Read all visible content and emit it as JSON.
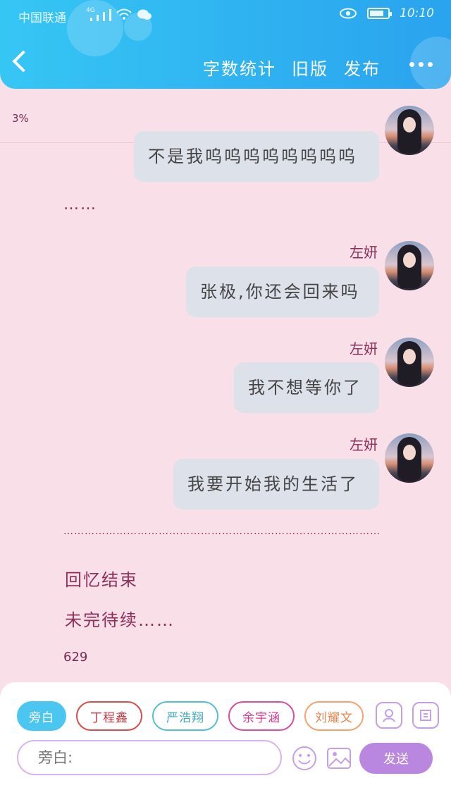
{
  "status_bar": {
    "carrier": "中国联通",
    "signal_label": "4G",
    "time": "10:10",
    "battery_level": 0.8
  },
  "header": {
    "actions": [
      "字数统计",
      "旧版",
      "发布"
    ],
    "more_icon": "more-horizontal-icon"
  },
  "progress": "3%",
  "messages": [
    {
      "text": "不是我呜呜呜呜呜呜呜呜"
    },
    {
      "name": "左妍",
      "text": "张极,你还会回来吗"
    },
    {
      "name": "左妍",
      "text": "我不想等你了"
    },
    {
      "name": "左妍",
      "text": "我要开始我的生活了"
    }
  ],
  "ellipsis_short": "……",
  "ellipsis_long": "………………………………………………………………………………",
  "narration": [
    "回忆结束",
    "未完待续……"
  ],
  "word_count": "629",
  "chips": [
    "旁白",
    "丁程鑫",
    "严浩翔",
    "余宇涵",
    "刘耀文"
  ],
  "tool_icons": [
    "user-card-icon",
    "label-icon",
    "emoji-icon",
    "image-icon"
  ],
  "input_placeholder": "旁白:",
  "send_label": "发送",
  "colors": {
    "header_gradient": "#36c6f4",
    "page_bg": "#f9dfe8",
    "accent": "#8d2f5b",
    "send_button": "#ba87e0"
  }
}
